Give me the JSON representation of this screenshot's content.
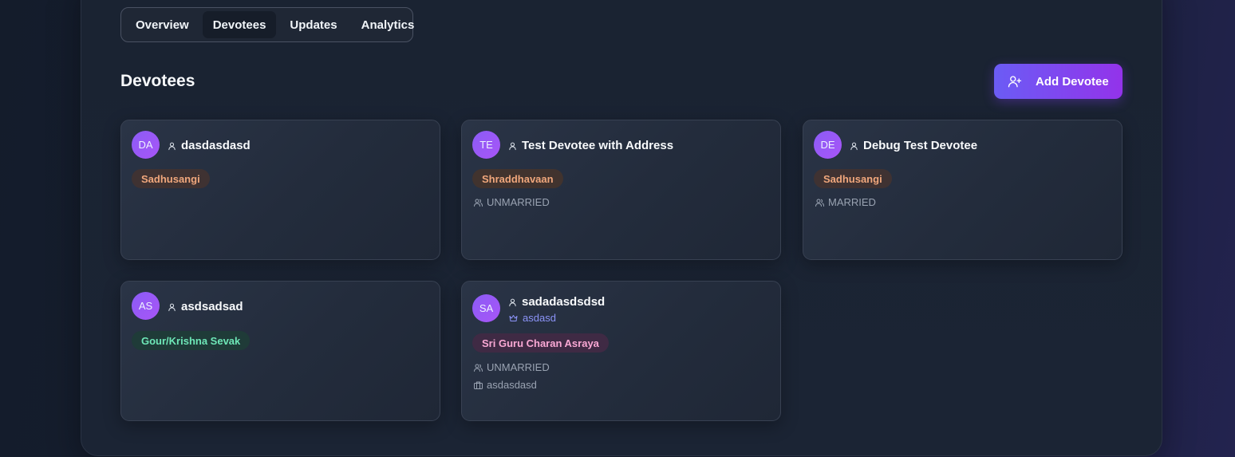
{
  "tabs": [
    {
      "label": "Overview",
      "active": false
    },
    {
      "label": "Devotees",
      "active": true
    },
    {
      "label": "Updates",
      "active": false
    },
    {
      "label": "Analytics",
      "active": false
    }
  ],
  "section_title": "Devotees",
  "add_button": {
    "label": "Add Devotee",
    "icon": "user-plus-icon"
  },
  "colors": {
    "accent_start": "#6b5cf5",
    "accent_end": "#9333ea"
  },
  "cards": [
    {
      "initials": "DA",
      "name": "dasdasdasd",
      "badge": "Sadhusangi"
    },
    {
      "initials": "TE",
      "name": "Test Devotee with Address",
      "badge": "Shraddhavaan",
      "marital": "UNMARRIED"
    },
    {
      "initials": "DE",
      "name": "Debug Test Devotee",
      "badge": "Sadhusangi",
      "marital": "MARRIED"
    },
    {
      "initials": "AS",
      "name": "asdsadsad",
      "badge": "Gour/Krishna Sevak"
    },
    {
      "initials": "SA",
      "name": "sadadasdsdsd",
      "sub": "asdasd",
      "badge": "Sri Guru Charan Asraya",
      "marital": "UNMARRIED",
      "occupation": "asdasdasd"
    }
  ]
}
